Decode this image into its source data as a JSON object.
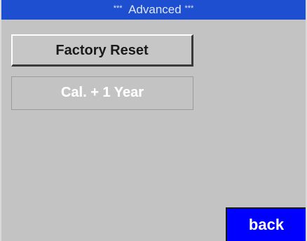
{
  "header": {
    "stars_left": "***",
    "title": "Advanced",
    "stars_right": "***"
  },
  "buttons": {
    "factory_reset": "Factory Reset",
    "cal_plus_year": "Cal. + 1 Year",
    "back": "back"
  },
  "colors": {
    "title_bar": "#1f4fd1",
    "background": "#c3c3c3",
    "back_button": "#0000ff"
  }
}
